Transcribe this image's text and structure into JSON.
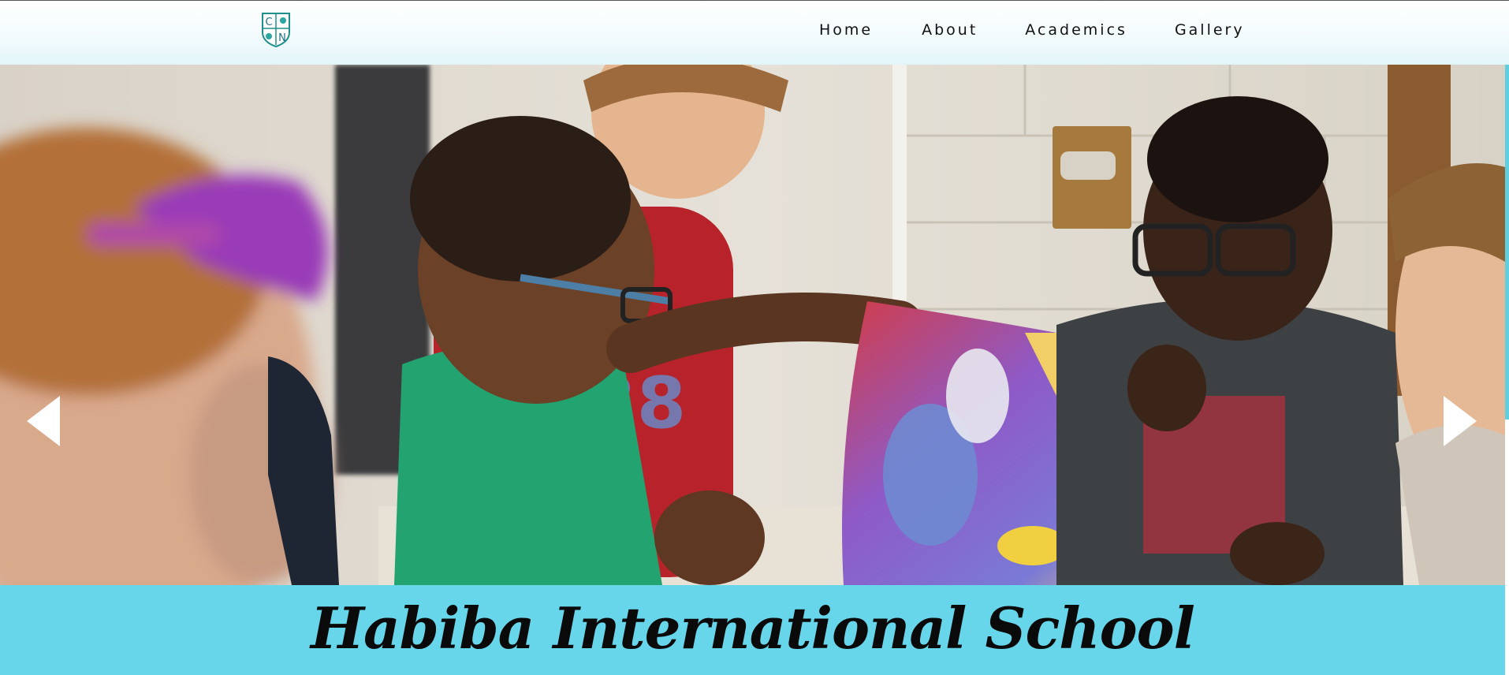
{
  "header": {
    "logo_letters": [
      "C",
      "N"
    ],
    "logo_icon": "school-crest-icon",
    "nav": [
      {
        "label": "Home"
      },
      {
        "label": "About"
      },
      {
        "label": "Academics"
      },
      {
        "label": "Gallery"
      }
    ]
  },
  "hero": {
    "image_icon": "children-reading-comic-photo",
    "prev_icon": "arrow-left-icon",
    "next_icon": "arrow-right-icon"
  },
  "banner": {
    "title": "Habiba International School"
  },
  "colors": {
    "banner": "#68d6ea",
    "accent": "#5fcfe0",
    "nav_text": "#111111"
  }
}
